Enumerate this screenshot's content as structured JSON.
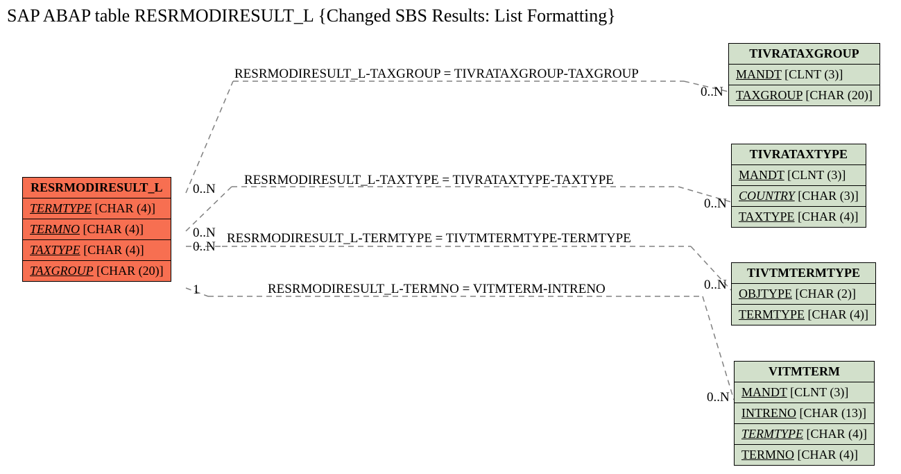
{
  "title": "SAP ABAP table RESRMODIRESULT_L {Changed SBS Results: List Formatting}",
  "source": {
    "name": "RESRMODIRESULT_L",
    "fields": [
      {
        "name": "TERMTYPE",
        "type": "[CHAR (4)]",
        "u": true,
        "i": true
      },
      {
        "name": "TERMNO",
        "type": "[CHAR (4)]",
        "u": true,
        "i": true
      },
      {
        "name": "TAXTYPE",
        "type": "[CHAR (4)]",
        "u": true,
        "i": true
      },
      {
        "name": "TAXGROUP",
        "type": "[CHAR (20)]",
        "u": true,
        "i": true
      }
    ]
  },
  "targets": [
    {
      "name": "TIVRATAXGROUP",
      "fields": [
        {
          "name": "MANDT",
          "type": "[CLNT (3)]",
          "u": true
        },
        {
          "name": "TAXGROUP",
          "type": "[CHAR (20)]",
          "u": true
        }
      ]
    },
    {
      "name": "TIVRATAXTYPE",
      "fields": [
        {
          "name": "MANDT",
          "type": "[CLNT (3)]",
          "u": true
        },
        {
          "name": "COUNTRY",
          "type": "[CHAR (3)]",
          "u": true,
          "i": true
        },
        {
          "name": "TAXTYPE",
          "type": "[CHAR (4)]",
          "u": true
        }
      ]
    },
    {
      "name": "TIVTMTERMTYPE",
      "fields": [
        {
          "name": "OBJTYPE",
          "type": "[CHAR (2)]",
          "u": true
        },
        {
          "name": "TERMTYPE",
          "type": "[CHAR (4)]",
          "u": true
        }
      ]
    },
    {
      "name": "VITMTERM",
      "fields": [
        {
          "name": "MANDT",
          "type": "[CLNT (3)]",
          "u": true
        },
        {
          "name": "INTRENO",
          "type": "[CHAR (13)]",
          "u": true
        },
        {
          "name": "TERMTYPE",
          "type": "[CHAR (4)]",
          "u": true,
          "i": true
        },
        {
          "name": "TERMNO",
          "type": "[CHAR (4)]",
          "u": true
        }
      ]
    }
  ],
  "relations": [
    {
      "text": "RESRMODIRESULT_L-TAXGROUP = TIVRATAXGROUP-TAXGROUP",
      "leftCard": "0..N",
      "rightCard": "0..N"
    },
    {
      "text": "RESRMODIRESULT_L-TAXTYPE = TIVRATAXTYPE-TAXTYPE",
      "leftCard": "0..N",
      "rightCard": "0..N"
    },
    {
      "text": "RESRMODIRESULT_L-TERMTYPE = TIVTMTERMTYPE-TERMTYPE",
      "leftCard": "0..N",
      "rightCard": "0..N"
    },
    {
      "text": "RESRMODIRESULT_L-TERMNO = VITMTERM-INTRENO",
      "leftCard": "1",
      "rightCard": "0..N"
    }
  ]
}
